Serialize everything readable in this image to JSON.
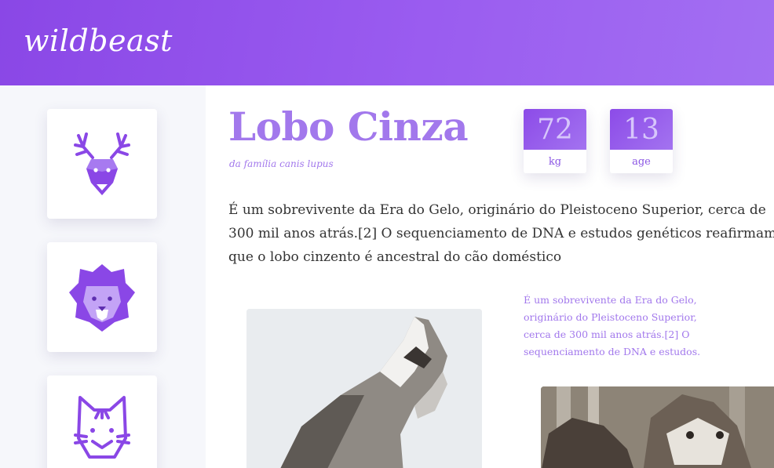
{
  "header": {
    "logo": "wildbeast"
  },
  "sidebar": {
    "icons": [
      {
        "name": "deer-icon"
      },
      {
        "name": "lion-icon"
      },
      {
        "name": "cat-icon"
      }
    ]
  },
  "article": {
    "title": "Lobo Cinza",
    "subtitle": "da família canis lupus",
    "stats": [
      {
        "value": "72",
        "unit": "kg"
      },
      {
        "value": "13",
        "unit": "age"
      }
    ],
    "body": "É um sobrevivente da Era do Gelo, originário do Pleistoceno Superior, cerca de 300 mil anos atrás.[2] O sequenciamento de DNA e estudos genéticos reafirmam que o lobo cinzento é ancestral do cão doméstico",
    "side_note": "É um sobrevivente da Era do Gelo, originário do Pleistoceno Superior, cerca de 300 mil anos atrás.[2] O sequenciamento de DNA e estudos."
  },
  "colors": {
    "accent": "#8a47e6",
    "accent_light": "#a278ec",
    "sidebar_bg": "#f6f7fb"
  }
}
